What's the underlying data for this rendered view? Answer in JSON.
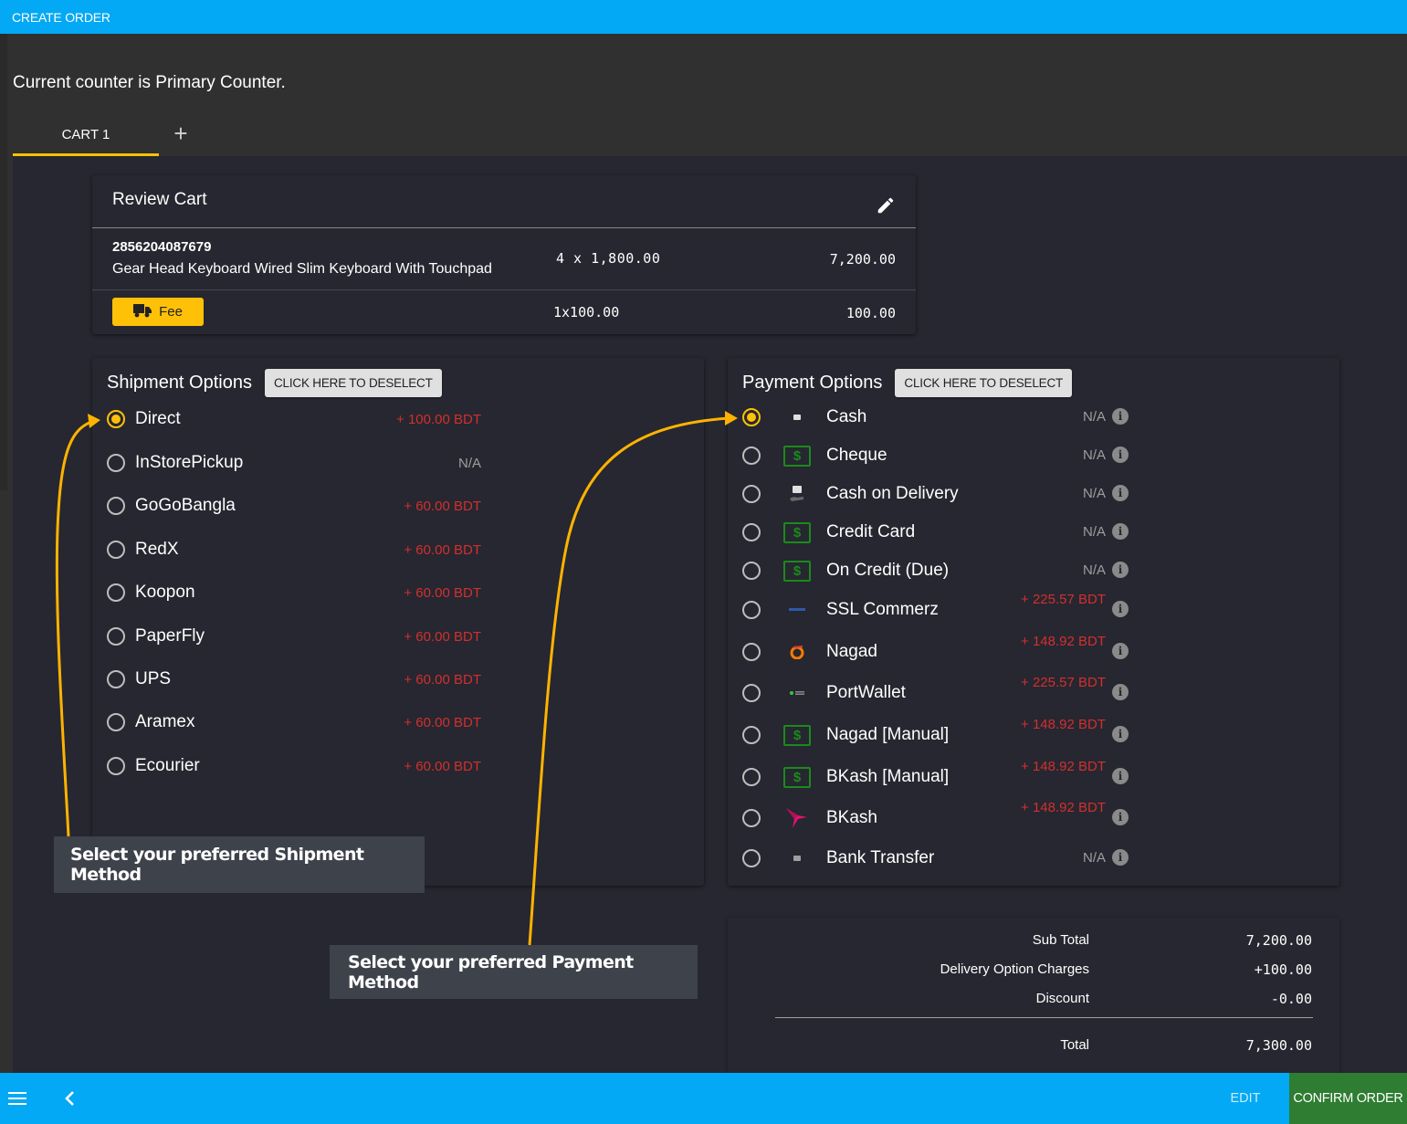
{
  "app": {
    "title": "CREATE ORDER"
  },
  "counter_text": "Current counter is Primary Counter.",
  "tabs": [
    {
      "label": "CART 1",
      "active": true
    }
  ],
  "add_tab_label": "+",
  "review_cart": {
    "title": "Review Cart",
    "items": [
      {
        "sku": "2856204087679",
        "name": "Gear Head Keyboard Wired Slim Keyboard With Touchpad",
        "qty_price": "4 x 1,800.00",
        "total": "7,200.00"
      }
    ],
    "fee": {
      "label": "Fee",
      "qty_price": "1x100.00",
      "total": "100.00"
    }
  },
  "shipment": {
    "title": "Shipment Options",
    "deselect_label": "CLICK HERE TO DESELECT",
    "options": [
      {
        "label": "Direct",
        "price": "+ 100.00 BDT",
        "selected": true
      },
      {
        "label": "InStorePickup",
        "price": "N/A",
        "selected": false
      },
      {
        "label": "GoGoBangla",
        "price": "+ 60.00 BDT",
        "selected": false
      },
      {
        "label": "RedX",
        "price": "+ 60.00 BDT",
        "selected": false
      },
      {
        "label": "Koopon",
        "price": "+ 60.00 BDT",
        "selected": false
      },
      {
        "label": "PaperFly",
        "price": "+ 60.00 BDT",
        "selected": false
      },
      {
        "label": "UPS",
        "price": "+ 60.00 BDT",
        "selected": false
      },
      {
        "label": "Aramex",
        "price": "+ 60.00 BDT",
        "selected": false
      },
      {
        "label": "Ecourier",
        "price": "+ 60.00 BDT",
        "selected": false
      }
    ]
  },
  "payment": {
    "title": "Payment Options",
    "deselect_label": "CLICK HERE TO DESELECT",
    "options": [
      {
        "label": "Cash",
        "price": "N/A",
        "icon": "cash-icon",
        "selected": true
      },
      {
        "label": "Cheque",
        "price": "N/A",
        "icon": "dollar-bill-icon",
        "selected": false
      },
      {
        "label": "Cash on Delivery",
        "price": "N/A",
        "icon": "cash-on-delivery-icon",
        "selected": false
      },
      {
        "label": "Credit Card",
        "price": "N/A",
        "icon": "dollar-bill-icon",
        "selected": false
      },
      {
        "label": "On Credit (Due)",
        "price": "N/A",
        "icon": "dollar-bill-icon",
        "selected": false
      },
      {
        "label": "SSL Commerz",
        "price": "+ 225.57 BDT",
        "icon": "sslcommerz-logo-icon",
        "selected": false
      },
      {
        "label": "Nagad",
        "price": "+ 148.92 BDT",
        "icon": "nagad-logo-icon",
        "selected": false
      },
      {
        "label": "PortWallet",
        "price": "+ 225.57 BDT",
        "icon": "portwallet-logo-icon",
        "selected": false
      },
      {
        "label": "Nagad [Manual]",
        "price": "+ 148.92 BDT",
        "icon": "dollar-bill-icon",
        "selected": false
      },
      {
        "label": "BKash [Manual]",
        "price": "+ 148.92 BDT",
        "icon": "dollar-bill-icon",
        "selected": false
      },
      {
        "label": "BKash",
        "price": "+ 148.92 BDT",
        "icon": "bkash-logo-icon",
        "selected": false
      },
      {
        "label": "Bank Transfer",
        "price": "N/A",
        "icon": "bank-transfer-icon",
        "selected": false
      }
    ]
  },
  "totals": {
    "rows": [
      {
        "label": "Sub Total",
        "value": "7,200.00"
      },
      {
        "label": "Delivery Option Charges",
        "value": "+100.00"
      },
      {
        "label": "Discount",
        "value": "-0.00"
      }
    ],
    "total_label": "Total",
    "total_value": "7,300.00"
  },
  "callouts": {
    "shipment": "Select your preferred Shipment Method",
    "payment": "Select your preferred Payment Method"
  },
  "colors": {
    "primary": "#03a9f4",
    "accent": "#ffc107",
    "confirm": "#2e7d32",
    "price": "#d32f2f"
  },
  "bottom_bar": {
    "edit_label": "EDIT",
    "confirm_label": "CONFIRM ORDER"
  }
}
